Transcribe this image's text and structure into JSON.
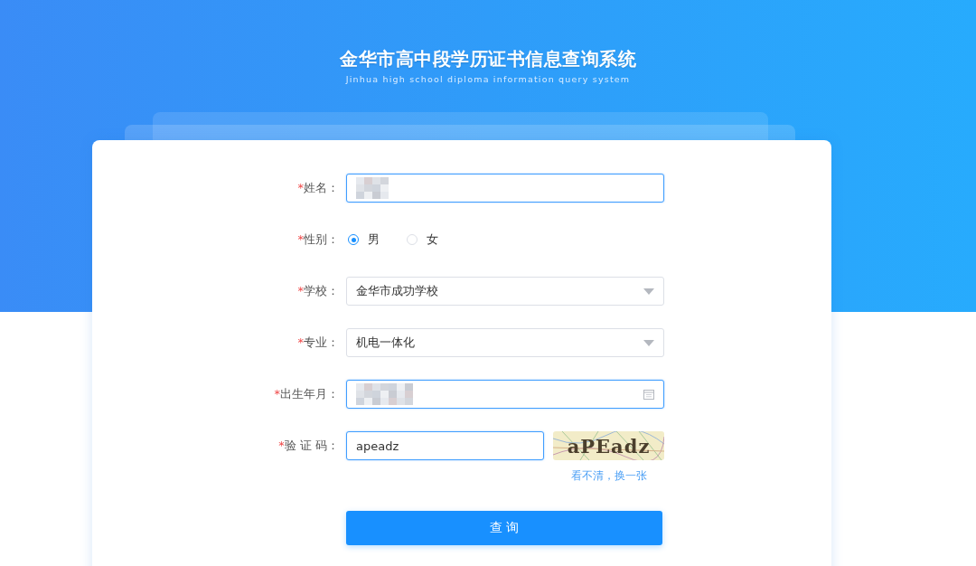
{
  "header": {
    "title": "金华市高中段学历证书信息查询系统",
    "subtitle": "Jinhua high school diploma information query system"
  },
  "form": {
    "fields": [
      {
        "kind": "text",
        "required_mark": "*",
        "label": "姓名：",
        "redacted": true,
        "focused": true
      },
      {
        "kind": "radio",
        "required_mark": "*",
        "label": "性别：",
        "options": [
          {
            "label": "男",
            "selected": true
          },
          {
            "label": "女",
            "selected": false
          }
        ]
      },
      {
        "kind": "select",
        "required_mark": "*",
        "label": "学校：",
        "value": "金华市成功学校",
        "focused": false
      },
      {
        "kind": "select",
        "required_mark": "*",
        "label": "专业：",
        "value": "机电一体化",
        "focused": false
      },
      {
        "kind": "date",
        "required_mark": "*",
        "label": "出生年月：",
        "redacted": true,
        "focused": true
      },
      {
        "kind": "captcha",
        "required_mark": "*",
        "label": "验 证 码：",
        "value": "apeadz",
        "focused": true,
        "captcha_text": "aPEadz",
        "refresh_link": "看不清，换一张"
      }
    ],
    "submit": "查 询"
  }
}
